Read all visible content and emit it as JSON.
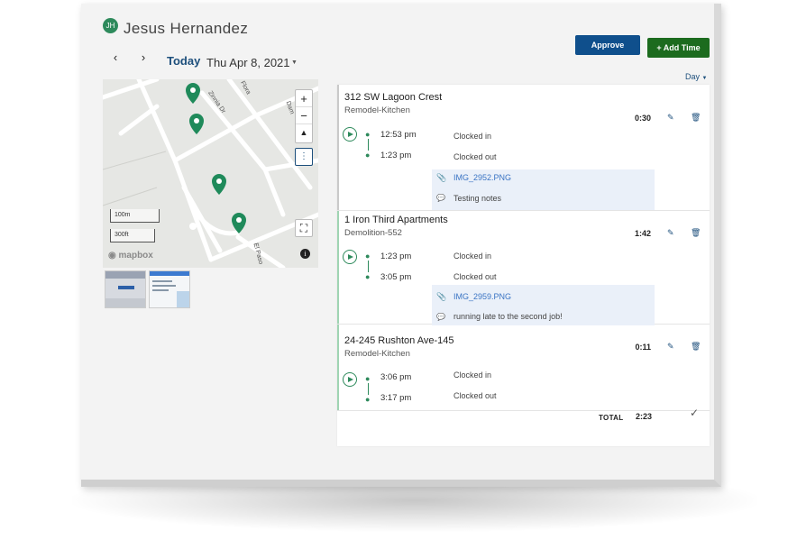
{
  "header": {
    "avatar_initials": "JH",
    "user_name": "Jesus Hernandez",
    "today_label": "Today",
    "date_label": "Thu Apr 8, 2021",
    "approve_label": "Approve",
    "add_time_label": "+ Add Time",
    "view_select": "Day"
  },
  "map": {
    "street_labels": [
      "Zinnia Dr",
      "Flora",
      "Dam",
      "El Paso"
    ],
    "scale_metric": "100m",
    "scale_imperial": "300ft",
    "logo_text": "mapbox",
    "zoom_in": "+",
    "zoom_out": "−",
    "compass": "▲",
    "more": "⋮",
    "expand": "⛶",
    "info": "i"
  },
  "entries": [
    {
      "title": "312 SW Lagoon Crest",
      "subtitle": "Remodel-Kitchen",
      "duration": "0:30",
      "time_in": "12:53 pm",
      "status_in": "Clocked in",
      "time_out": "1:23 pm",
      "status_out": "Clocked out",
      "attachment": "IMG_2952.PNG",
      "note": "Testing notes"
    },
    {
      "title": "1 Iron Third Apartments",
      "subtitle": "Demolition-552",
      "duration": "1:42",
      "time_in": "1:23 pm",
      "status_in": "Clocked in",
      "time_out": "3:05 pm",
      "status_out": "Clocked out",
      "attachment": "IMG_2959.PNG",
      "note": "running late to the second job!"
    },
    {
      "title": "24-245 Rushton Ave-145",
      "subtitle": "Remodel-Kitchen",
      "duration": "0:11",
      "time_in": "3:06 pm",
      "status_in": "Clocked in",
      "time_out": "3:17 pm",
      "status_out": "Clocked out"
    }
  ],
  "total": {
    "label": "TOTAL",
    "value": "2:23"
  },
  "colors": {
    "approve": "#0f4f8c",
    "add_time": "#1c6b1e",
    "pin": "#1f8a5a",
    "accent_text": "#1d4f7c"
  },
  "icons": {
    "prev": "chevron-left-icon",
    "next": "chevron-right-icon",
    "edit": "edit-icon",
    "delete": "trash-icon",
    "play": "play-icon",
    "location": "map-pin-icon",
    "attachment": "paperclip-icon",
    "comment": "comment-icon",
    "check": "check-icon"
  }
}
